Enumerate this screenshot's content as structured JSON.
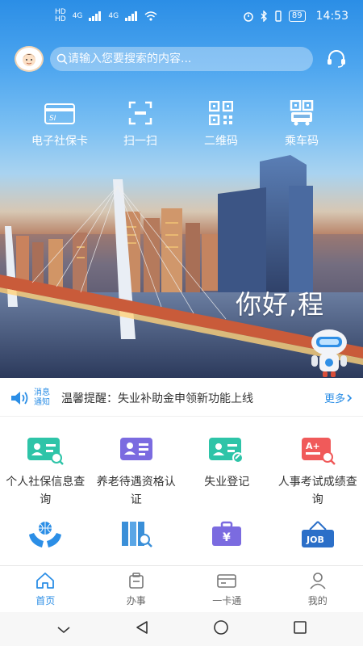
{
  "status": {
    "network1": "HD",
    "network2": "HD",
    "signal1": "4G",
    "signal2": "4G",
    "battery": "89",
    "time": "14:53"
  },
  "search": {
    "placeholder": "请输入您要搜索的内容..."
  },
  "quick_actions": [
    {
      "label": "电子社保卡",
      "icon": "social-security-card-icon"
    },
    {
      "label": "扫一扫",
      "icon": "scan-icon"
    },
    {
      "label": "二维码",
      "icon": "qr-code-icon"
    },
    {
      "label": "乘车码",
      "icon": "bus-code-icon"
    }
  ],
  "greeting": "你好,程",
  "notice": {
    "tag_line1": "消息",
    "tag_line2": "通知",
    "text": "温馨提醒：失业补助金申领新功能上线",
    "more": "更多"
  },
  "services": [
    {
      "label": "个人社保信息查询",
      "icon": "id-card-search-icon",
      "color": "#2ec4a8"
    },
    {
      "label": "养老待遇资格认证",
      "icon": "pension-cert-icon",
      "color": "#7b6be0"
    },
    {
      "label": "失业登记",
      "icon": "unemployment-register-icon",
      "color": "#2ec4a8"
    },
    {
      "label": "人事考试成绩查询",
      "icon": "exam-score-icon",
      "color": "#f05a5a"
    },
    {
      "label": "",
      "icon": "globe-hands-icon",
      "color": "#2b8ee6"
    },
    {
      "label": "",
      "icon": "document-search-icon",
      "color": "#3a8fd8"
    },
    {
      "label": "",
      "icon": "yuan-briefcase-icon",
      "color": "#7b6be0"
    },
    {
      "label": "",
      "icon": "job-sign-icon",
      "color": "#2b6fc8"
    }
  ],
  "tabs": [
    {
      "label": "首页",
      "active": true
    },
    {
      "label": "办事",
      "active": false
    },
    {
      "label": "一卡通",
      "active": false
    },
    {
      "label": "我的",
      "active": false
    }
  ],
  "colors": {
    "accent": "#2b8ee6",
    "teal": "#2ec4a8",
    "purple": "#7b6be0",
    "red": "#f05a5a"
  }
}
